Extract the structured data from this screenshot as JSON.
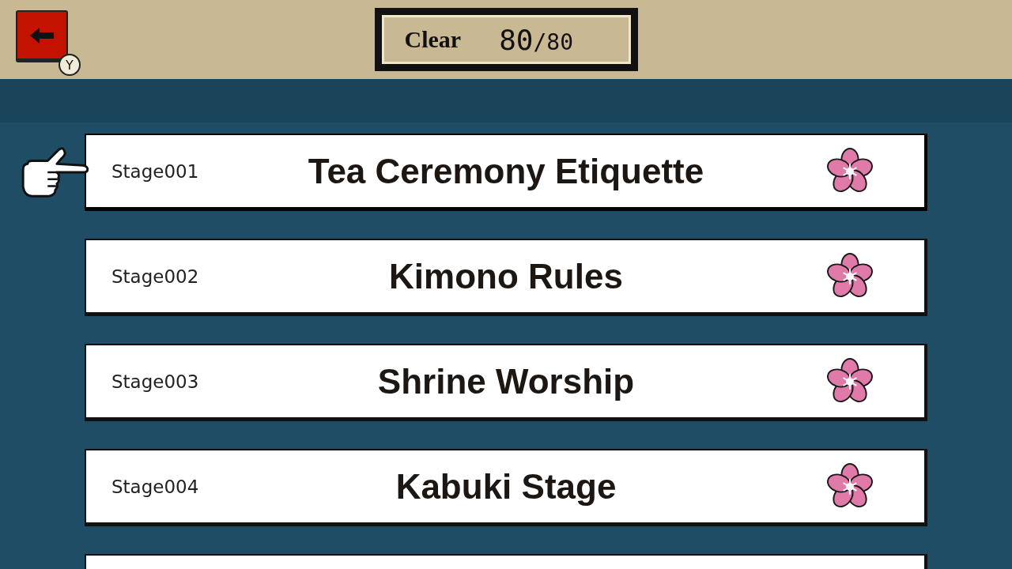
{
  "back_button": {
    "key_hint": "Y"
  },
  "score": {
    "label": "Clear",
    "cleared": "80",
    "total": "/80"
  },
  "stages": [
    {
      "number": "Stage001",
      "title": "Tea Ceremony Etiquette",
      "selected": true,
      "cleared": true
    },
    {
      "number": "Stage002",
      "title": "Kimono Rules",
      "selected": false,
      "cleared": true
    },
    {
      "number": "Stage003",
      "title": "Shrine Worship",
      "selected": false,
      "cleared": true
    },
    {
      "number": "Stage004",
      "title": "Kabuki Stage",
      "selected": false,
      "cleared": true
    }
  ]
}
